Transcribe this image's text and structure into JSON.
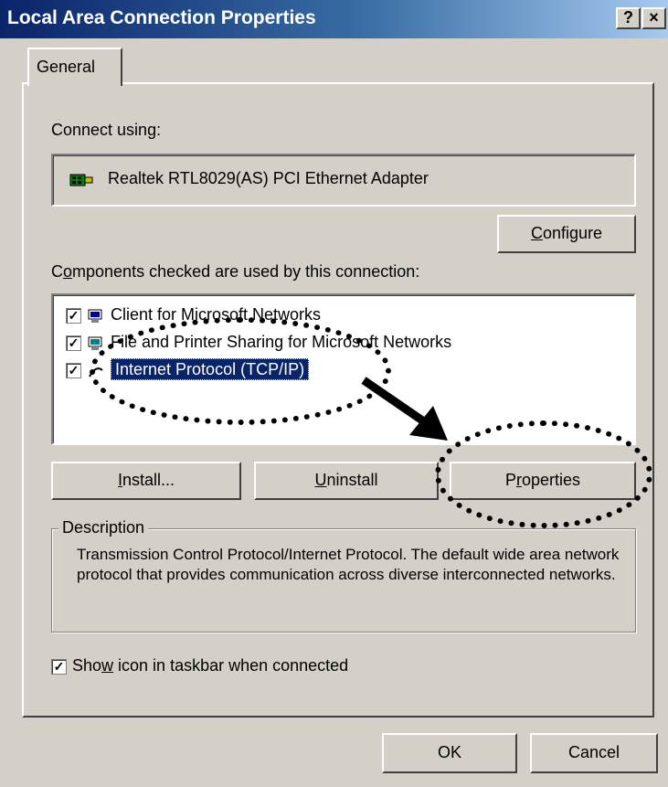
{
  "window": {
    "title": "Local Area Connection Properties",
    "help_btn": "?",
    "close_btn": "×"
  },
  "tabs": [
    {
      "label": "General"
    }
  ],
  "connect_using_label": "Connect using:",
  "adapter": {
    "name": "Realtek RTL8029(AS) PCI Ethernet Adapter"
  },
  "configure_button": {
    "prefix": "",
    "accel": "C",
    "rest": "onfigure"
  },
  "components_label": {
    "prefix": "C",
    "accel": "o",
    "rest": "mponents checked are used by this connection:"
  },
  "components": [
    {
      "label": "Client for Microsoft Networks",
      "checked": true
    },
    {
      "label": "File and Printer Sharing for Microsoft Networks",
      "checked": true
    },
    {
      "label": "Internet Protocol (TCP/IP)",
      "checked": true,
      "selected": true
    }
  ],
  "install_button": {
    "prefix": "",
    "accel": "I",
    "rest": "nstall..."
  },
  "uninstall_button": {
    "prefix": "",
    "accel": "U",
    "rest": "ninstall"
  },
  "properties_button": {
    "prefix": "P",
    "accel": "r",
    "rest": "operties"
  },
  "description": {
    "title": "Description",
    "text": "Transmission Control Protocol/Internet Protocol. The default wide area network protocol that provides communication across diverse interconnected networks."
  },
  "show_icon": {
    "prefix": "Sho",
    "accel": "w",
    "rest": " icon in taskbar when connected",
    "checked": true
  },
  "ok_button": "OK",
  "cancel_button": "Cancel",
  "colors": {
    "title_start": "#0a246a",
    "title_end": "#a6caf0",
    "face": "#d4d0c8",
    "selection": "#0a246a"
  }
}
